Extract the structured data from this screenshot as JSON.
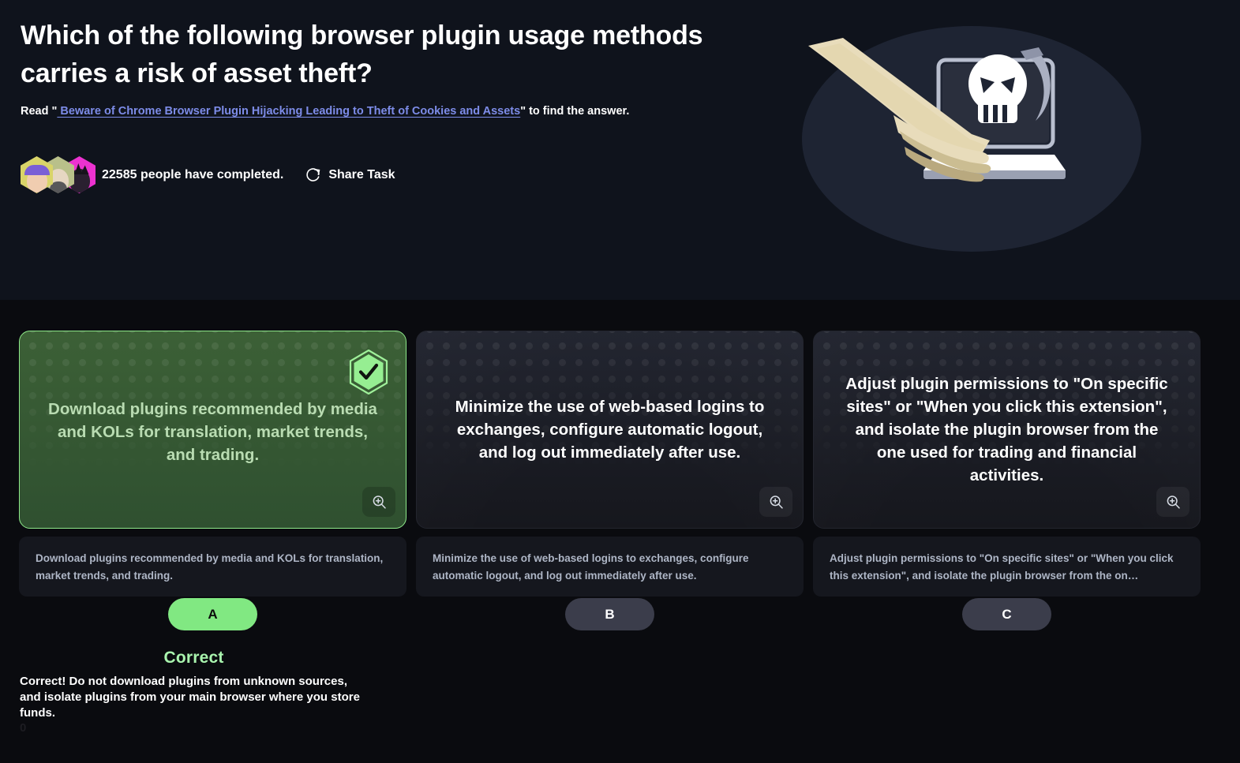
{
  "hero": {
    "question": "Which of the following browser plugin usage methods carries a risk of asset theft?",
    "read_prefix": "Read \"",
    "article_link": " Beware of Chrome Browser Plugin Hijacking Leading to Theft of Cookies and Assets",
    "read_suffix": "\" to find the answer.",
    "completed_text": "22585 people have completed.",
    "share_label": "Share Task",
    "illustration_name": "laptop-skull-hand-illustration"
  },
  "options": [
    {
      "letter": "A",
      "text": "Download plugins recommended by media and KOLs for translation, market trends, and trading.",
      "caption": "Download plugins recommended by media and KOLs for translation, market trends, and trading.",
      "state": "correct-selected",
      "badge_icon": "check-hexagon-icon",
      "magnify_icon": "zoom-in-icon"
    },
    {
      "letter": "B",
      "text": "Minimize the use of web-based logins to exchanges, configure automatic logout, and log out immediately after use.",
      "caption": "Minimize the use of web-based logins to exchanges, configure automatic logout, and log out immediately after use.",
      "state": "normal",
      "magnify_icon": "zoom-in-icon"
    },
    {
      "letter": "C",
      "text": "Adjust plugin permissions to \"On specific sites\" or \"When you click this extension\", and isolate the plugin browser from the one used for trading and financial activities.",
      "caption": "Adjust plugin permissions to \"On specific sites\" or \"When you click this extension\", and isolate the plugin browser from the on…",
      "state": "normal",
      "magnify_icon": "zoom-in-icon"
    }
  ],
  "feedback": {
    "verdict": "Correct",
    "detail": "Correct! Do not download plugins from unknown sources, and isolate plugins from your main browser where you store funds.",
    "trailing": "0"
  },
  "colors": {
    "hero_bg": "#0f131c",
    "page_bg": "#0a0b0f",
    "accent_green": "#81e882",
    "correct_card_bg": "#3c6036",
    "link_blue": "#7d8ce8",
    "neutral_button": "#3b3d4b",
    "caption_bg": "#15171e"
  }
}
